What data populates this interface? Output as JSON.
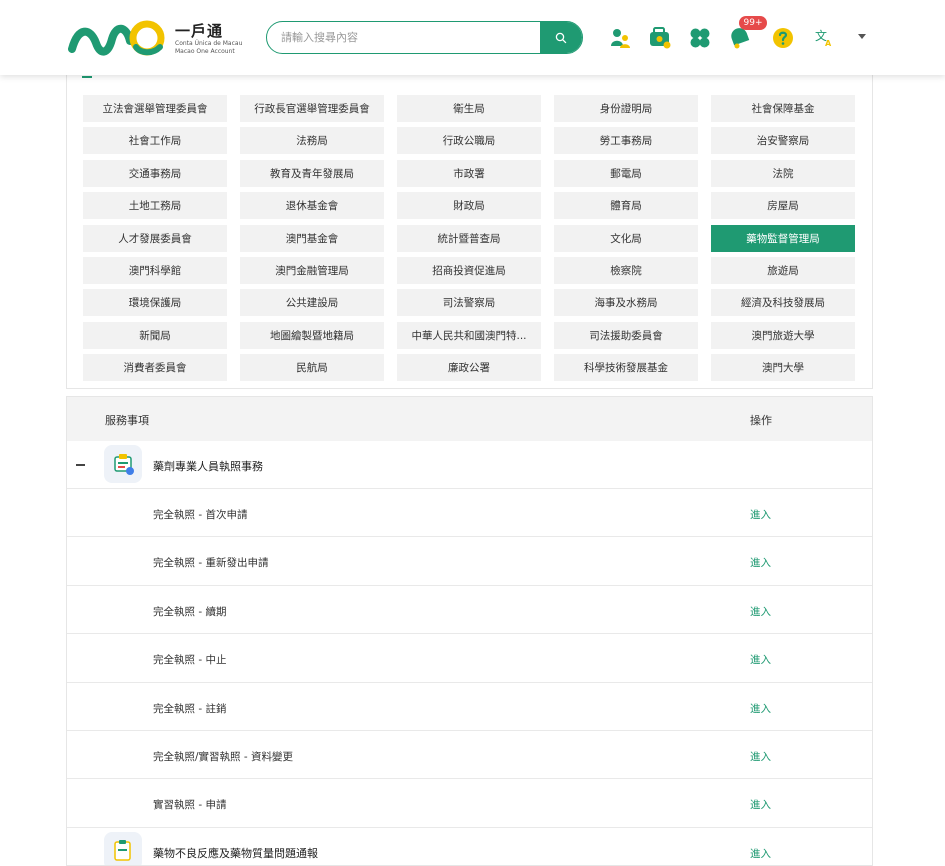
{
  "header": {
    "brand_title": "一戶通",
    "brand_sub_pt": "Conta Única de Macau",
    "brand_sub_en": "Macao One Account",
    "search_placeholder": "請輸入搜尋內容",
    "notification_badge": "99+",
    "language_icon_label": "文A",
    "icons": [
      "family-icon",
      "briefcase-icon",
      "clover-icon",
      "bell-icon",
      "help-icon",
      "language-icon",
      "caret-down-icon"
    ],
    "accent_color": "#1f9a72"
  },
  "departments": [
    "立法會選舉管理委員會",
    "行政長官選舉管理委員會",
    "衛生局",
    "身份證明局",
    "社會保障基金",
    "社會工作局",
    "法務局",
    "行政公職局",
    "勞工事務局",
    "治安警察局",
    "交通事務局",
    "教育及青年發展局",
    "市政署",
    "郵電局",
    "法院",
    "土地工務局",
    "退休基金會",
    "財政局",
    "體育局",
    "房屋局",
    "人才發展委員會",
    "澳門基金會",
    "統計暨普查局",
    "文化局",
    "藥物監督管理局",
    "澳門科學館",
    "澳門金融管理局",
    "招商投資促進局",
    "檢察院",
    "旅遊局",
    "環境保護局",
    "公共建設局",
    "司法警察局",
    "海事及水務局",
    "經濟及科技發展局",
    "新聞局",
    "地圖繪製暨地籍局",
    "中華人民共和國澳門特...",
    "司法援助委員會",
    "澳門旅遊大學",
    "消費者委員會",
    "民航局",
    "廉政公署",
    "科學技術發展基金",
    "澳門大學"
  ],
  "active_department": "藥物監督管理局",
  "table": {
    "col_service": "服務事項",
    "col_action": "操作",
    "group1_title": "藥劑專業人員執照事務",
    "group2_title": "藥物不良反應及藥物質量問題通報",
    "group2_action": "進入",
    "rows": [
      {
        "name": "完全執照 - 首次申請",
        "action": "進入"
      },
      {
        "name": "完全執照 - 重新發出申請",
        "action": "進入"
      },
      {
        "name": "完全執照 - 續期",
        "action": "進入"
      },
      {
        "name": "完全執照 - 中止",
        "action": "進入"
      },
      {
        "name": "完全執照 - 註銷",
        "action": "進入"
      },
      {
        "name": "完全執照/實習執照 - 資料變更",
        "action": "進入"
      },
      {
        "name": "實習執照 - 申請",
        "action": "進入"
      }
    ]
  }
}
